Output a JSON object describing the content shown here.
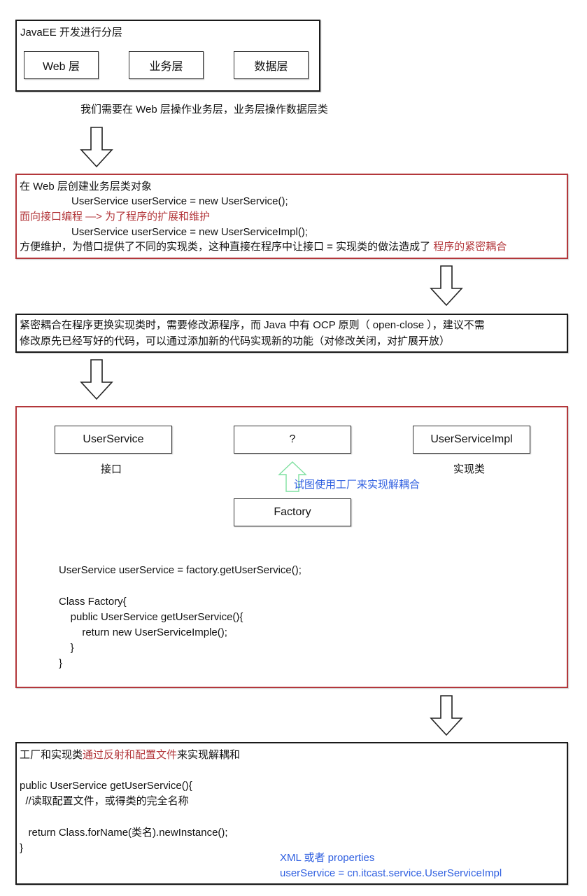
{
  "section1": {
    "title": "JavaEE 开发进行分层",
    "layers": [
      "Web 层",
      "业务层",
      "数据层"
    ]
  },
  "caption1": "我们需要在 Web 层操作业务层，业务层操作数据层类",
  "section2": {
    "line1": "在 Web 层创建业务层类对象",
    "line2": "UserService userService = new UserService();",
    "line3": "面向接口编程 —> 为了程序的扩展和维护",
    "line4": "UserService userService = new UserServiceImpl();",
    "line5_prefix": "方便维护，为借口提供了不同的实现类，这种直接在程序中让接口 = 实现类的做法造成了 ",
    "line5_highlight": "程序的紧密耦合"
  },
  "section3": {
    "line1": "紧密耦合在程序更换实现类时，需要修改源程序，而 Java 中有 OCP 原则（ open-close ），建议不需",
    "line2": "修改原先已经写好的代码，可以通过添加新的代码实现新的功能（对修改关闭，对扩展开放）"
  },
  "section4": {
    "nodes": {
      "interface": "UserService",
      "unknown": "?",
      "impl": "UserServiceImpl",
      "factory": "Factory"
    },
    "labels": {
      "interface": "接口",
      "impl": "实现类",
      "factory_note": "试图使用工厂来实现解耦合"
    },
    "code": [
      "UserService userService = factory.getUserService();",
      "",
      "Class Factory{",
      "    public UserService getUserService(){",
      "        return new UserServiceImple();",
      "    }",
      "}"
    ]
  },
  "section5": {
    "title_prefix": "工厂和实现类",
    "title_highlight": "通过反射和配置文件",
    "title_suffix": "来实现解耦和",
    "code": [
      "public UserService getUserService(){",
      "  //读取配置文件，或得类的完全名称",
      "",
      "   return Class.forName(类名).newInstance();",
      "}"
    ],
    "config_note1": "XML 或者 properties",
    "config_note2": "userService = cn.itcast.service.UserServiceImpl"
  },
  "colors": {
    "highlight_red": "#b3373b",
    "note_blue": "#2f5fe0",
    "arrow_green": "#7fe0a0"
  }
}
